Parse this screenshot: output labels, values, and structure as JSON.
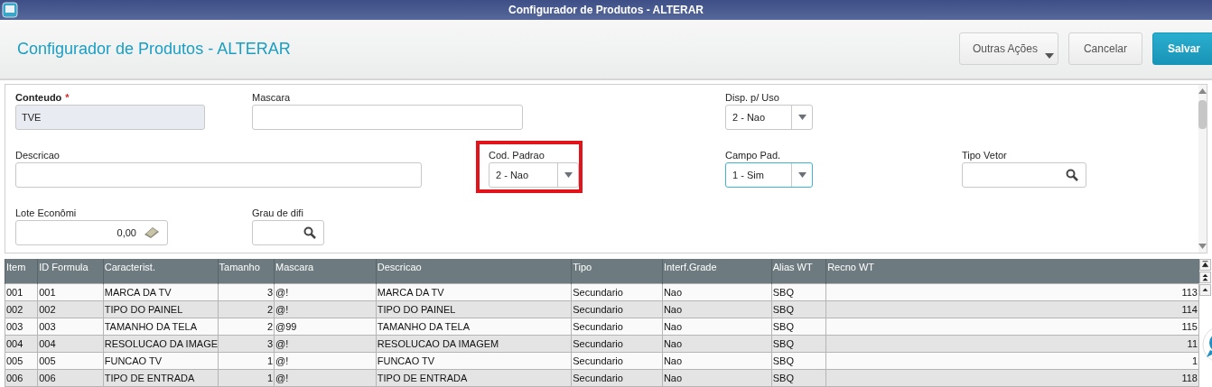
{
  "window": {
    "title": "Configurador de Produtos - ALTERAR"
  },
  "header": {
    "title": "Configurador de Produtos - ALTERAR",
    "buttons": [
      {
        "label": "Outras Ações",
        "kind": "menu"
      },
      {
        "label": "Cancelar",
        "kind": "secondary"
      },
      {
        "label": "Salvar",
        "kind": "primary"
      }
    ]
  },
  "form": {
    "fields": [
      {
        "label": "Conteudo",
        "required_mark": "*",
        "kind": "text",
        "value": "TVE",
        "disabled": true,
        "focused": false,
        "highlighted": false
      },
      {
        "label": "Mascara",
        "kind": "text",
        "disabled": false,
        "focused": false,
        "highlighted": false
      },
      {
        "label": "Disp. p/ Uso",
        "kind": "select",
        "value": "2 - Nao",
        "disabled": false,
        "focused": false,
        "highlighted": false
      },
      {
        "label": "Descricao",
        "kind": "text",
        "disabled": false,
        "focused": false,
        "highlighted": false
      },
      {
        "label": "Cod. Padrao",
        "kind": "select",
        "value": "2 - Nao",
        "disabled": false,
        "focused": false,
        "highlighted": true
      },
      {
        "label": "Campo Pad.",
        "kind": "select",
        "value": "1 - Sim",
        "disabled": false,
        "focused": true,
        "highlighted": false
      },
      {
        "label": "Tipo Vetor",
        "kind": "lookup",
        "disabled": false,
        "focused": false,
        "highlighted": false
      },
      {
        "label": "Lote Econômi",
        "kind": "number",
        "value": "0,00",
        "disabled": false,
        "focused": false,
        "highlighted": false
      },
      {
        "label": "Grau de difi",
        "kind": "lookup",
        "disabled": false,
        "focused": false,
        "highlighted": false
      }
    ]
  },
  "table": {
    "columns": [
      "Item",
      "ID Formula",
      "Caracterist.",
      "Tamanho",
      "Mascara",
      "Descricao",
      "Tipo",
      "Interf.Grade",
      "Alias WT",
      "Recno WT"
    ],
    "rows": [
      [
        "001",
        "001",
        "MARCA DA TV",
        "3",
        "@!",
        "MARCA DA TV",
        "Secundario",
        "Nao",
        "SBQ",
        "113"
      ],
      [
        "002",
        "002",
        "TIPO DO PAINEL",
        "2",
        "@!",
        "TIPO DO PAINEL",
        "Secundario",
        "Nao",
        "SBQ",
        "114"
      ],
      [
        "003",
        "003",
        "TAMANHO DA TELA",
        "2",
        "@99",
        "TAMANHO DA TELA",
        "Secundario",
        "Nao",
        "SBQ",
        "115"
      ],
      [
        "004",
        "004",
        "RESOLUCAO DA IMAGE",
        "3",
        "@!",
        "RESOLUCAO DA IMAGEM",
        "Secundario",
        "Nao",
        "SBQ",
        "11"
      ],
      [
        "005",
        "005",
        "FUNCAO TV",
        "1",
        "@!",
        "FUNCAO TV",
        "Secundario",
        "Nao",
        "SBQ",
        "1"
      ],
      [
        "006",
        "006",
        "TIPO DE ENTRADA",
        "1",
        "@!",
        "TIPO DE ENTRADA",
        "Secundario",
        "Nao",
        "SBQ",
        "118"
      ]
    ]
  }
}
